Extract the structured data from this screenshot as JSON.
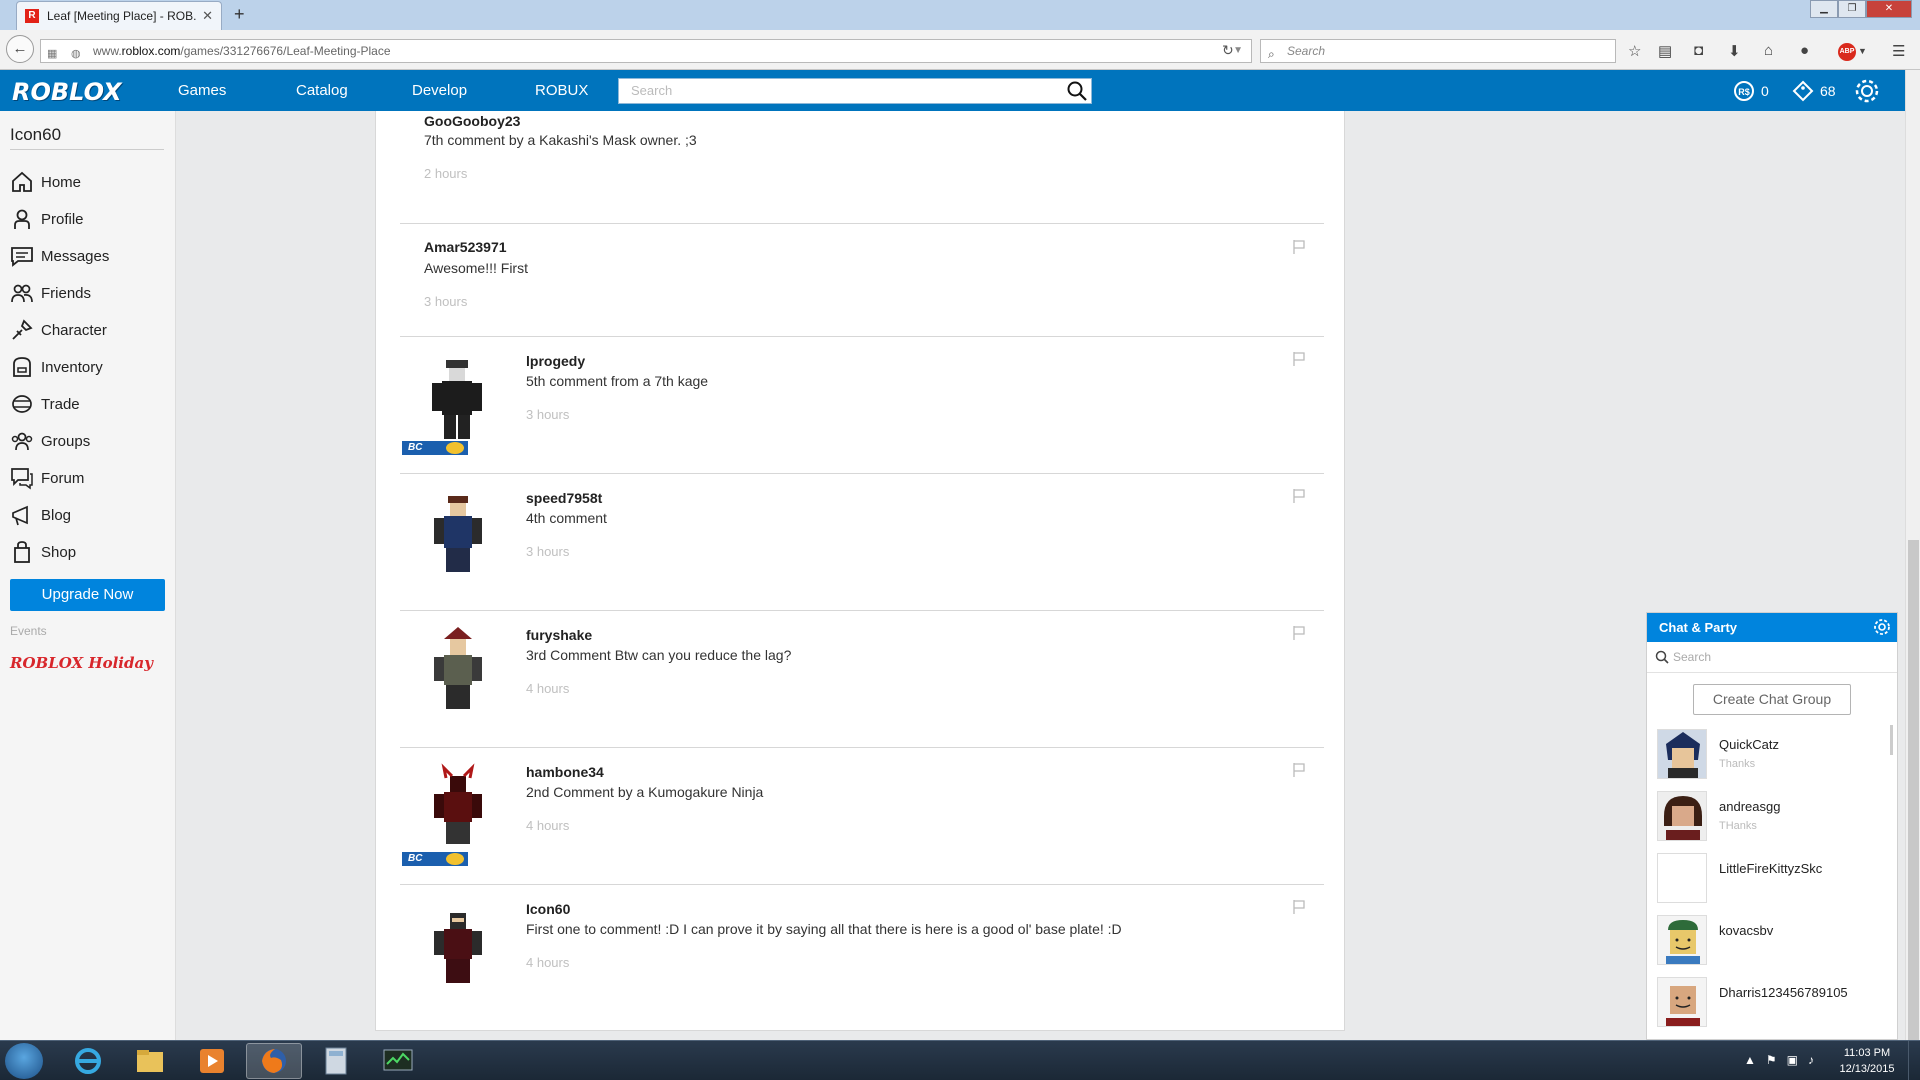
{
  "browser": {
    "tab_title": "Leaf [Meeting Place] - ROB...",
    "tab_favicon": "R",
    "new_tab": "+",
    "url_prefix": "www.",
    "url_domain": "roblox.com",
    "url_path": "/games/331276676/Leaf-Meeting-Place",
    "search_placeholder": "Search",
    "abp_label": "ABP"
  },
  "header": {
    "logo": "ROBLOX",
    "nav": [
      "Games",
      "Catalog",
      "Develop",
      "ROBUX"
    ],
    "search_placeholder": "Search",
    "robux_count": "0",
    "tix_count": "68",
    "accent": "#0074bd"
  },
  "sidebar": {
    "username": "Icon60",
    "items": [
      {
        "label": "Home",
        "icon": "home-icon"
      },
      {
        "label": "Profile",
        "icon": "profile-icon"
      },
      {
        "label": "Messages",
        "icon": "messages-icon"
      },
      {
        "label": "Friends",
        "icon": "friends-icon"
      },
      {
        "label": "Character",
        "icon": "character-icon"
      },
      {
        "label": "Inventory",
        "icon": "inventory-icon"
      },
      {
        "label": "Trade",
        "icon": "trade-icon"
      },
      {
        "label": "Groups",
        "icon": "groups-icon"
      },
      {
        "label": "Forum",
        "icon": "forum-icon"
      },
      {
        "label": "Blog",
        "icon": "blog-icon"
      },
      {
        "label": "Shop",
        "icon": "shop-icon"
      }
    ],
    "upgrade_label": "Upgrade Now",
    "events_label": "Events",
    "holiday_label": "ROBLOX Holiday"
  },
  "comments": [
    {
      "user": "GooGooboy23",
      "text": "7th comment by a Kakashi's Mask owner. ;3",
      "time": "2 hours",
      "avatar": false,
      "bc": false
    },
    {
      "user": "Amar523971",
      "text": "Awesome!!! First",
      "time": "3 hours",
      "avatar": false,
      "bc": false
    },
    {
      "user": "lprogedy",
      "text": "5th comment from a 7th kage",
      "time": "3 hours",
      "avatar": true,
      "bc": true
    },
    {
      "user": "speed7958t",
      "text": "4th comment",
      "time": "3 hours",
      "avatar": true,
      "bc": false
    },
    {
      "user": "furyshake",
      "text": "3rd Comment Btw can you reduce the lag?",
      "time": "4 hours",
      "avatar": true,
      "bc": false
    },
    {
      "user": "hambone34",
      "text": "2nd Comment by a Kumogakure Ninja",
      "time": "4 hours",
      "avatar": true,
      "bc": true
    },
    {
      "user": "Icon60",
      "text": "First one to comment! :D I can prove it by saying all that there is here is a good ol' base plate! :D",
      "time": "4 hours",
      "avatar": true,
      "bc": false
    }
  ],
  "bc_label": "BC",
  "chat": {
    "title": "Chat & Party",
    "search_placeholder": "Search",
    "create_group": "Create Chat Group",
    "friends": [
      {
        "name": "QuickCatz",
        "message": "Thanks"
      },
      {
        "name": "andreasgg",
        "message": "THanks"
      },
      {
        "name": "LittleFireKittyzSkc",
        "message": ""
      },
      {
        "name": "kovacsbv",
        "message": ""
      },
      {
        "name": "Dharris123456789105",
        "message": ""
      }
    ]
  },
  "taskbar": {
    "time": "11:03 PM",
    "date": "12/13/2015"
  }
}
